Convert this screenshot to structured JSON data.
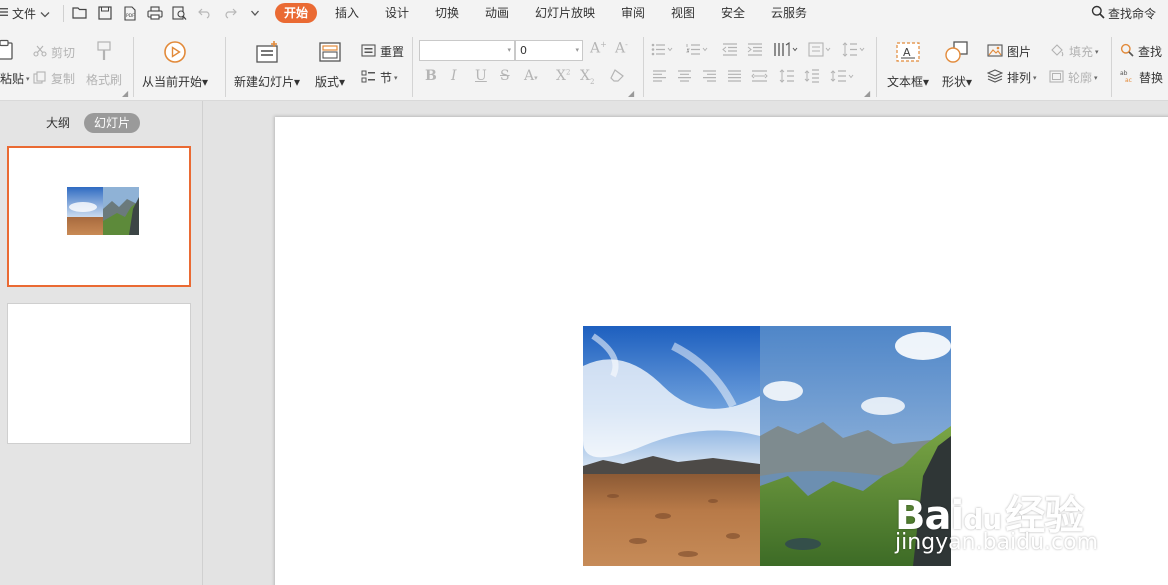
{
  "menubar": {
    "file_label": "文件",
    "tabs": [
      {
        "label": "开始",
        "active": true
      },
      {
        "label": "插入"
      },
      {
        "label": "设计"
      },
      {
        "label": "切换"
      },
      {
        "label": "动画"
      },
      {
        "label": "幻灯片放映"
      },
      {
        "label": "审阅"
      },
      {
        "label": "视图"
      },
      {
        "label": "安全"
      },
      {
        "label": "云服务"
      }
    ],
    "find_command": "查找命令"
  },
  "ribbon": {
    "paste_label": "粘贴",
    "cut_label": "剪切",
    "copy_label": "复制",
    "format_painter_label": "格式刷",
    "from_current_label": "从当前开始",
    "new_slide_label": "新建幻灯片",
    "layout_label": "版式",
    "reset_label": "重置",
    "section_label": "节",
    "font_name_value": "",
    "font_size_value": "0",
    "textbox_label": "文本框",
    "shape_label": "形状",
    "picture_label": "图片",
    "arrange_label": "排列",
    "fill_label": "填充",
    "outline_label": "轮廓",
    "find_label": "查找",
    "replace_label": "替换"
  },
  "left_panel": {
    "tab_outline": "大纲",
    "tab_slides": "幻灯片",
    "selected_slide": 1,
    "slide_count": 2
  },
  "watermark": {
    "brand_latin": "Bai",
    "brand_du": "du",
    "brand_cn": "经验",
    "site": "jingyan.baidu.com"
  },
  "colors": {
    "accent": "#ea6a33",
    "ribbon_bg": "#f3f3f3",
    "panel_bg": "#e4e4e4",
    "disabled": "#b3b3b3"
  }
}
